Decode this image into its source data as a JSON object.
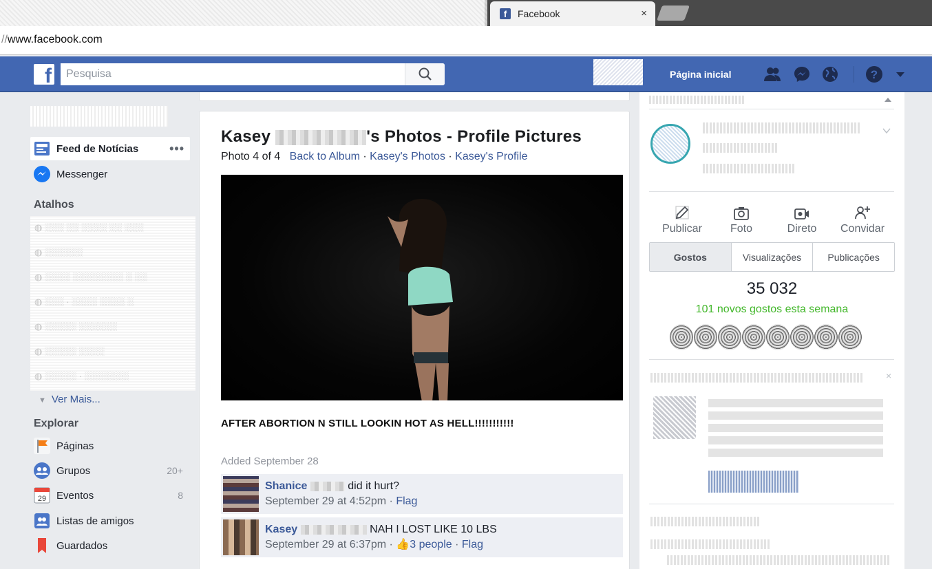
{
  "browser": {
    "tab_title": "Facebook",
    "tab_close": "×",
    "address": {
      "prefix": "//",
      "host": "www.facebook.com"
    }
  },
  "topbar": {
    "search_placeholder": "Pesquisa",
    "home_label": "Página inicial",
    "logo_letter": "f"
  },
  "leftnav": {
    "items": [
      {
        "label": "Feed de Notícias",
        "icon": "news-feed-icon",
        "more": "•••"
      },
      {
        "label": "Messenger",
        "icon": "messenger-icon"
      }
    ],
    "shortcuts_heading": "Atalhos",
    "see_more": "Ver Mais...",
    "explore_heading": "Explorar",
    "explore_items": [
      {
        "label": "Páginas",
        "icon": "flag-icon",
        "count": ""
      },
      {
        "label": "Grupos",
        "icon": "groups-icon",
        "count": "20+"
      },
      {
        "label": "Eventos",
        "icon": "calendar-icon",
        "count": "8",
        "icon_text": "29"
      },
      {
        "label": "Listas de amigos",
        "icon": "friend-lists-icon",
        "count": ""
      },
      {
        "label": "Guardados",
        "icon": "bookmark-icon",
        "count": ""
      }
    ]
  },
  "post": {
    "title_first": "Kasey",
    "title_rest": "'s Photos - Profile Pictures",
    "photo_counter": "Photo 4 of 4",
    "links": [
      "Back to Album",
      "Kasey's Photos",
      "Kasey's Profile"
    ],
    "link_sep": "·",
    "caption": "AFTER ABORTION N STILL LOOKIN HOT AS HELL!!!!!!!!!!!",
    "added": "Added September 28",
    "comments": [
      {
        "name": "Shanice",
        "text": "did it hurt?",
        "time": "September 29 at 4:52pm",
        "flag": "Flag",
        "likes": ""
      },
      {
        "name": "Kasey",
        "text": "NAH I LOST LIKE 10 LBS",
        "time": "September 29 at 6:37pm",
        "flag": "Flag",
        "likes": "3 people"
      }
    ]
  },
  "rightcol": {
    "actions": [
      {
        "label": "Publicar",
        "icon": "edit-icon"
      },
      {
        "label": "Foto",
        "icon": "camera-icon"
      },
      {
        "label": "Direto",
        "icon": "live-video-icon"
      },
      {
        "label": "Convidar",
        "icon": "invite-icon"
      }
    ],
    "stats_tabs": [
      "Gostos",
      "Visualizações",
      "Publicações"
    ],
    "likes_total": "35 032",
    "likes_week": "101 novos gostos esta semana"
  },
  "colors": {
    "fb_blue": "#4267b2",
    "link": "#3b5998",
    "green": "#42b72a"
  }
}
